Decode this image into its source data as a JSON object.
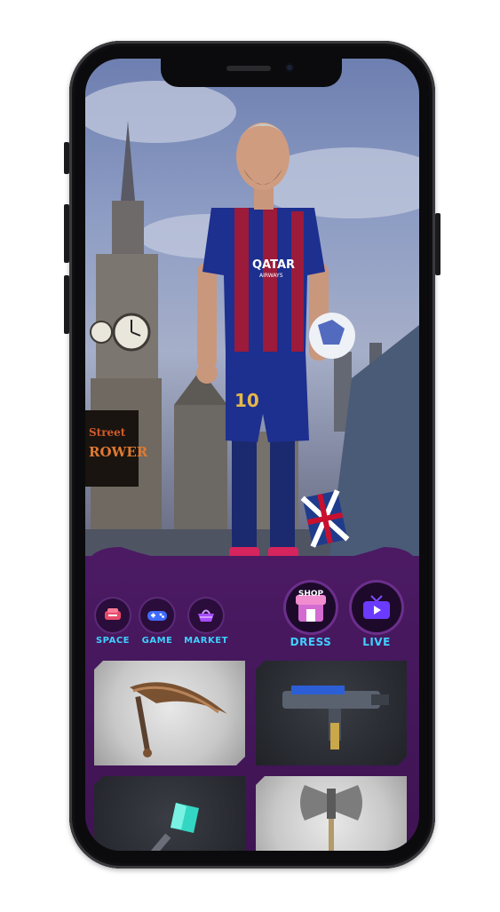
{
  "nav": {
    "items": [
      {
        "label": "SPACE",
        "icon": "space-icon"
      },
      {
        "label": "GAME",
        "icon": "gamepad-icon"
      },
      {
        "label": "MARKET",
        "icon": "basket-icon"
      }
    ],
    "shop_badge": "SHOP",
    "dress_label": "DRESS",
    "live_label": "LIVE"
  },
  "hero": {
    "jersey_sponsor": "QATAR",
    "jersey_sponsor_sub": "AIRWAYS",
    "jersey_number": "10",
    "sign_line1": "Street",
    "sign_line2": "ROWER"
  },
  "inventory": {
    "items": [
      {
        "icon": "scythe-icon"
      },
      {
        "icon": "blaster-gun-icon"
      },
      {
        "icon": "crystal-staff-icon"
      },
      {
        "icon": "battle-axe-icon"
      }
    ]
  },
  "colors": {
    "accent": "#3fd0ff",
    "panel": "#4b1a63",
    "jersey_blue": "#1d2f8f",
    "jersey_red": "#9c1a3a"
  }
}
